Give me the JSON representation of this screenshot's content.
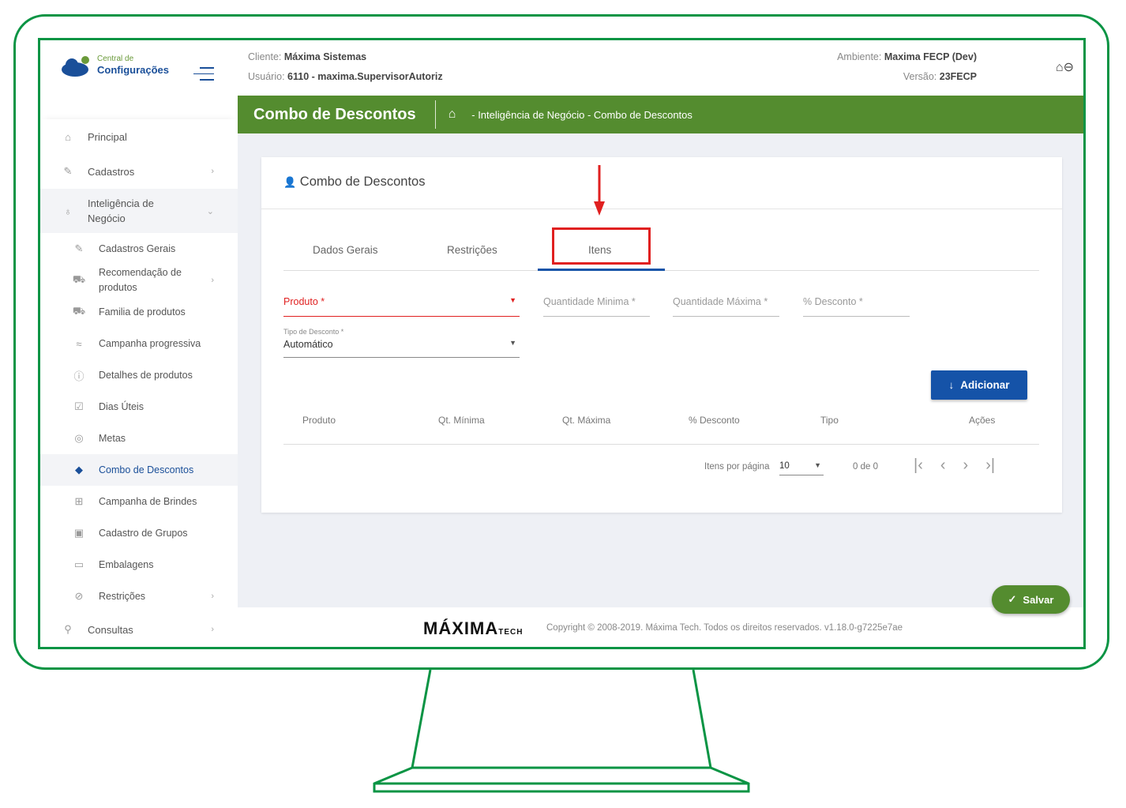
{
  "app": {
    "logo_top": "Central de",
    "logo_bottom": "Configurações"
  },
  "header": {
    "client_label": "Cliente:",
    "client": "Máxima Sistemas",
    "user_label": "Usuário:",
    "user": "6110 - maxima.SupervisorAutoriz",
    "env_label": "Ambiente:",
    "env": "Maxima FECP (Dev)",
    "version_label": "Versão:",
    "version": "23FECP"
  },
  "page": {
    "title": "Combo de Descontos",
    "breadcrumb": "- Inteligência de Negócio - Combo de Descontos"
  },
  "sidebar": {
    "items": [
      {
        "label": "Principal",
        "icon": "home-icon"
      },
      {
        "label": "Cadastros",
        "icon": "edit-icon"
      },
      {
        "label": "Inteligência de Negócio",
        "icon": "lightbulb-icon"
      },
      {
        "label": "Cadastros Gerais",
        "icon": "edit-icon"
      },
      {
        "label": "Recomendação de produtos",
        "icon": "cart-icon"
      },
      {
        "label": "Familia de produtos",
        "icon": "cart-icon"
      },
      {
        "label": "Campanha progressiva",
        "icon": "trend-icon"
      },
      {
        "label": "Detalhes de produtos",
        "icon": "info-icon"
      },
      {
        "label": "Dias Úteis",
        "icon": "calendar-icon"
      },
      {
        "label": "Metas",
        "icon": "target-icon"
      },
      {
        "label": "Combo de Descontos",
        "icon": "tags-icon"
      },
      {
        "label": "Campanha de Brindes",
        "icon": "gift-icon"
      },
      {
        "label": "Cadastro de Grupos",
        "icon": "group-icon"
      },
      {
        "label": "Embalagens",
        "icon": "box-icon"
      },
      {
        "label": "Restrições",
        "icon": "block-icon"
      },
      {
        "label": "Consultas",
        "icon": "search-icon"
      }
    ]
  },
  "card": {
    "title": "Combo de Descontos",
    "tabs": [
      "Dados Gerais",
      "Restrições",
      "Itens"
    ],
    "fields": {
      "produto": "Produto *",
      "qmin": "Quantidade Minima *",
      "qmax": "Quantidade Máxima *",
      "desconto": "% Desconto *",
      "tipo_label": "Tipo de Desconto *",
      "tipo_value": "Automático"
    },
    "add_button": "Adicionar",
    "columns": [
      "Produto",
      "Qt. Mínima",
      "Qt. Máxima",
      "% Desconto",
      "Tipo",
      "Ações"
    ],
    "pagination": {
      "label": "Itens por página",
      "per_page": "10",
      "range": "0 de 0"
    }
  },
  "save_button": "Salvar",
  "footer": {
    "brand": "MÁXIMA TECH",
    "copyright": "Copyright © 2008-2019. Máxima Tech. Todos os direitos reservados. v1.18.0-g7225e7ae"
  },
  "colors": {
    "green": "#548c2f",
    "blue": "#1553a8",
    "red": "#e02020",
    "frame": "#0a9444"
  }
}
